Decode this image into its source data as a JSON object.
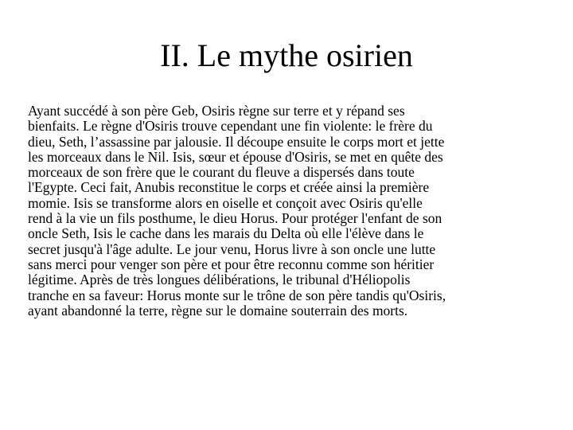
{
  "slide": {
    "title": "II. Le mythe osirien",
    "body_lines": [
      "Ayant succédé à son père Geb, Osiris règne sur terre et y répand ses",
      "bienfaits. Le règne d'Osiris trouve cependant une fin violente: le frère du",
      "dieu, Seth, l’assassine par jalousie. Il découpe ensuite le corps mort et jette",
      "les morceaux dans le Nil. Isis, sœur et épouse d'Osiris, se met en quête des",
      "morceaux de son frère que le courant du fleuve a dispersés dans toute",
      "l'Egypte. Ceci fait, Anubis reconstitue le corps et créée ainsi la première",
      "momie. Isis se transforme alors en oiselle et conçoit avec Osiris qu'elle",
      "rend à la vie un fils posthume, le dieu Horus. Pour protéger l'enfant de son",
      "oncle Seth, Isis le cache dans les marais du Delta où elle l'élève dans le",
      "secret jusqu'à l'âge adulte. Le jour venu, Horus livre à son oncle une lutte",
      "sans merci pour venger son père et pour être reconnu comme son héritier",
      "légitime. Après de très longues délibérations, le tribunal d'Héliopolis",
      "tranche en sa faveur: Horus monte sur le trône de son père tandis qu'Osiris,",
      "ayant abandonné la terre, règne sur le domaine souterrain des morts."
    ]
  }
}
